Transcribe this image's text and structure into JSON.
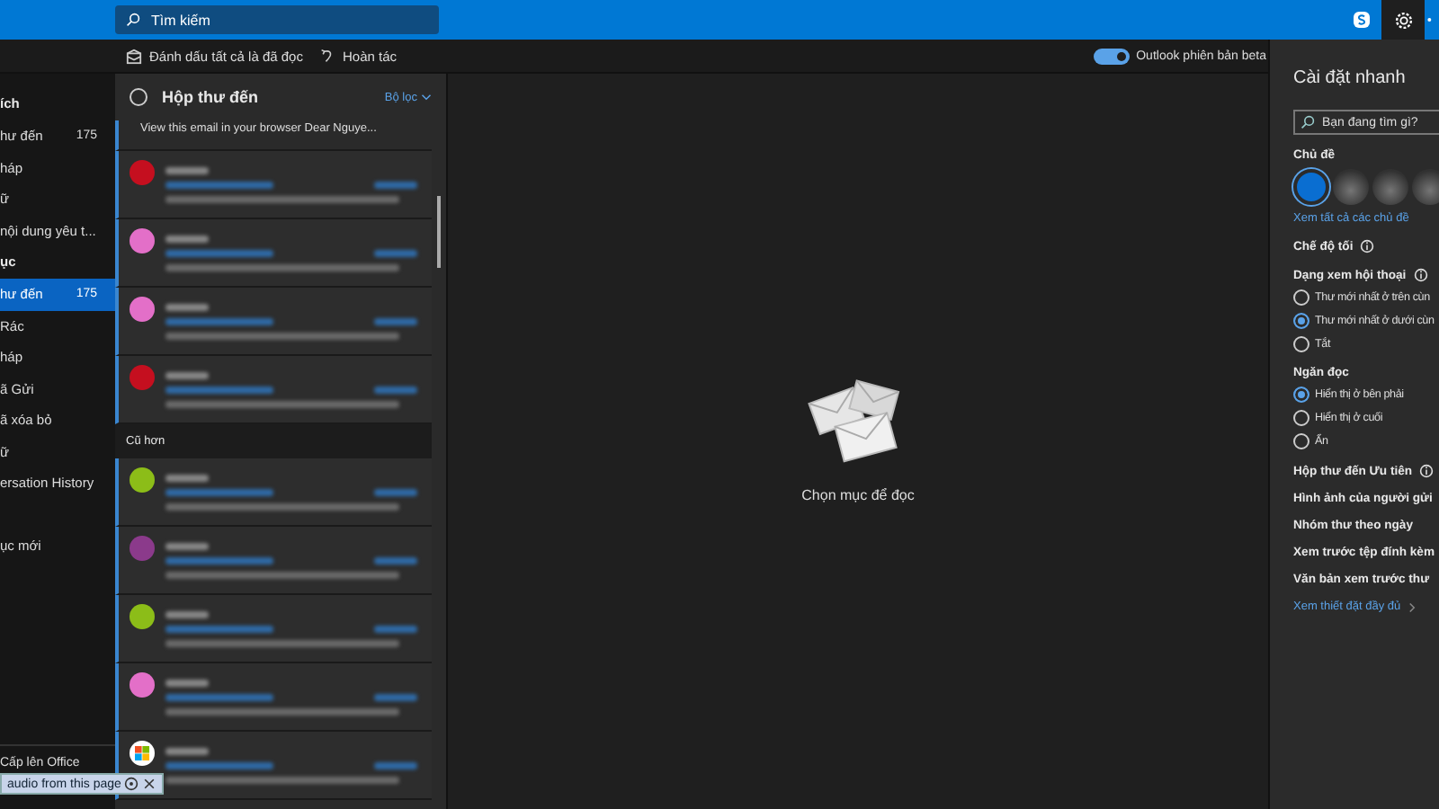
{
  "search": {
    "placeholder": "Tìm kiếm"
  },
  "toolbar": {
    "actions": [
      {
        "kind": "mark-read",
        "label": "Đánh dấu tất cả là đã đọc"
      },
      {
        "kind": "undo",
        "label": "Hoàn tác"
      }
    ],
    "beta_toggle": {
      "label": "Outlook phiên bản beta",
      "on": true
    }
  },
  "sidebar": {
    "items": [
      {
        "kind": "header",
        "label": "ích"
      },
      {
        "kind": "folder",
        "label": "hư đến",
        "count": "175",
        "selected": false
      },
      {
        "kind": "folder",
        "label": "háp",
        "selected": false
      },
      {
        "kind": "folder",
        "label": "ữ",
        "selected": false
      },
      {
        "kind": "folder",
        "label": "nội dung yêu t...",
        "selected": false
      },
      {
        "kind": "header",
        "label": "ục"
      },
      {
        "kind": "folder",
        "label": "hư đến",
        "count": "175",
        "selected": true
      },
      {
        "kind": "folder",
        "label": "Rác",
        "selected": false
      },
      {
        "kind": "folder",
        "label": "háp",
        "selected": false
      },
      {
        "kind": "folder",
        "label": "ã Gửi",
        "selected": false
      },
      {
        "kind": "folder",
        "label": "ã xóa bỏ",
        "selected": false
      },
      {
        "kind": "folder",
        "label": "ữ",
        "selected": false
      },
      {
        "kind": "folder",
        "label": "ersation History",
        "selected": false
      },
      {
        "kind": "spacer"
      },
      {
        "kind": "folder",
        "label": "ục mới",
        "selected": false
      }
    ],
    "footer": "Cấp lên Office"
  },
  "message_list": {
    "select_all_checked": false,
    "title": "Hộp thư đến",
    "filter": "Bộ lọc",
    "partial_preview": "View this email in your browser Dear Nguye...",
    "items": [
      {
        "kind": "avatar",
        "color": "#c50f1f",
        "unread": true
      },
      {
        "kind": "avatar",
        "color": "#e36fc8",
        "unread": true
      },
      {
        "kind": "avatar",
        "color": "#e36fc8",
        "unread": true
      },
      {
        "kind": "avatar",
        "color": "#c50f1f",
        "unread": true
      },
      {
        "kind": "section",
        "label": "Cũ hơn"
      },
      {
        "kind": "avatar",
        "color": "#8cbd18",
        "unread": true
      },
      {
        "kind": "avatar",
        "color": "#8b3a8b",
        "unread": true
      },
      {
        "kind": "avatar",
        "color": "#8cbd18",
        "unread": true
      },
      {
        "kind": "avatar",
        "color": "#e36fc8",
        "unread": true
      },
      {
        "kind": "logo",
        "unread": true
      }
    ]
  },
  "reading_pane": {
    "empty_text": "Chọn mục để đọc"
  },
  "quick_settings": {
    "title": "Cài đặt nhanh",
    "search_placeholder": "Bạn đang tìm gì?",
    "sections": [
      {
        "heading": "Chủ đề",
        "info": false,
        "themes": [
          {
            "kind": "color",
            "color": "#0a6ed1",
            "selected": true
          },
          {
            "kind": "image",
            "selected": false
          },
          {
            "kind": "image",
            "selected": false
          },
          {
            "kind": "image",
            "selected": false
          }
        ],
        "link": "Xem tất cả các chủ đề"
      },
      {
        "heading": "Chế độ tối",
        "info": true
      },
      {
        "heading": "Dạng xem hội thoại",
        "info": true,
        "options": [
          {
            "label": "Thư mới nhất ở trên cùn",
            "selected": false
          },
          {
            "label": "Thư mới nhất ở dưới cùn",
            "selected": true
          },
          {
            "label": "Tắt",
            "selected": false
          }
        ]
      },
      {
        "heading": "Ngăn đọc",
        "info": false,
        "options": [
          {
            "label": "Hiển thị ở bên phải",
            "selected": true
          },
          {
            "label": "Hiển thị ở cuối",
            "selected": false
          },
          {
            "label": "Ẩn",
            "selected": false
          }
        ]
      },
      {
        "heading": "Hộp thư đến Ưu tiên",
        "info": true
      },
      {
        "heading": "Hình ảnh của người gửi",
        "info": false
      },
      {
        "heading": "Nhóm thư theo ngày",
        "info": false
      },
      {
        "heading": "Xem trước tệp đính kèm",
        "info": false
      },
      {
        "heading": "Văn bản xem trước thư",
        "info": false
      }
    ],
    "footer_link": "Xem thiết đặt đầy đủ"
  },
  "overlay": {
    "text": "audio from this page"
  }
}
